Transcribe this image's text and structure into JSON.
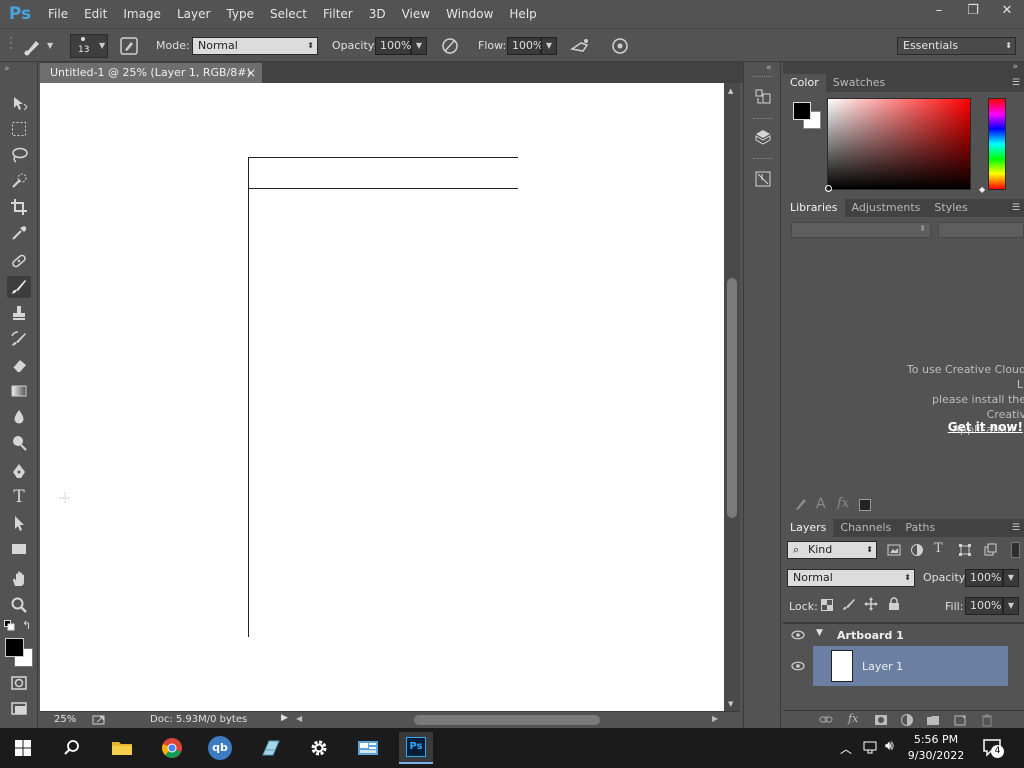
{
  "app": {
    "logo": "Ps"
  },
  "menu": [
    "File",
    "Edit",
    "Image",
    "Layer",
    "Type",
    "Select",
    "Filter",
    "3D",
    "View",
    "Window",
    "Help"
  ],
  "window_controls": {
    "minimize": "–",
    "restore": "❐",
    "close": "✕"
  },
  "options": {
    "brush_size": "13",
    "mode_label": "Mode:",
    "mode_value": "Normal",
    "opacity_label": "Opacity:",
    "opacity_value": "100%",
    "flow_label": "Flow:",
    "flow_value": "100%",
    "workspace": "Essentials"
  },
  "document": {
    "tab_title": "Untitled-1 @ 25% (Layer 1, RGB/8#)",
    "close": "×",
    "zoom": "25%",
    "doc_info": "Doc: 5.93M/0 bytes"
  },
  "color_panel": {
    "tabs": [
      "Color",
      "Swatches"
    ],
    "foreground": "#000000",
    "background": "#ffffff"
  },
  "libraries_panel": {
    "tabs": [
      "Libraries",
      "Adjustments",
      "Styles"
    ],
    "message_lines": [
      "To use Creative Cloud Li",
      "please install the Creativ",
      "Application"
    ],
    "link": "Get it now!"
  },
  "layers_panel": {
    "tabs": [
      "Layers",
      "Channels",
      "Paths"
    ],
    "filter_kind": "Kind",
    "blend_mode": "Normal",
    "opacity_label": "Opacity:",
    "opacity_value": "100%",
    "lock_label": "Lock:",
    "fill_label": "Fill:",
    "fill_value": "100%",
    "layers": [
      {
        "name": "Artboard 1",
        "type": "group"
      },
      {
        "name": "Layer 1",
        "type": "layer",
        "selected": true
      }
    ]
  },
  "taskbar": {
    "time": "5:56 PM",
    "date": "9/30/2022",
    "notifications": "4",
    "ps_label": "Ps",
    "qb_label": "qb"
  },
  "colors": {
    "accent": "#4aa3df",
    "panel": "#535353",
    "selected_layer": "#6b7fa3"
  }
}
